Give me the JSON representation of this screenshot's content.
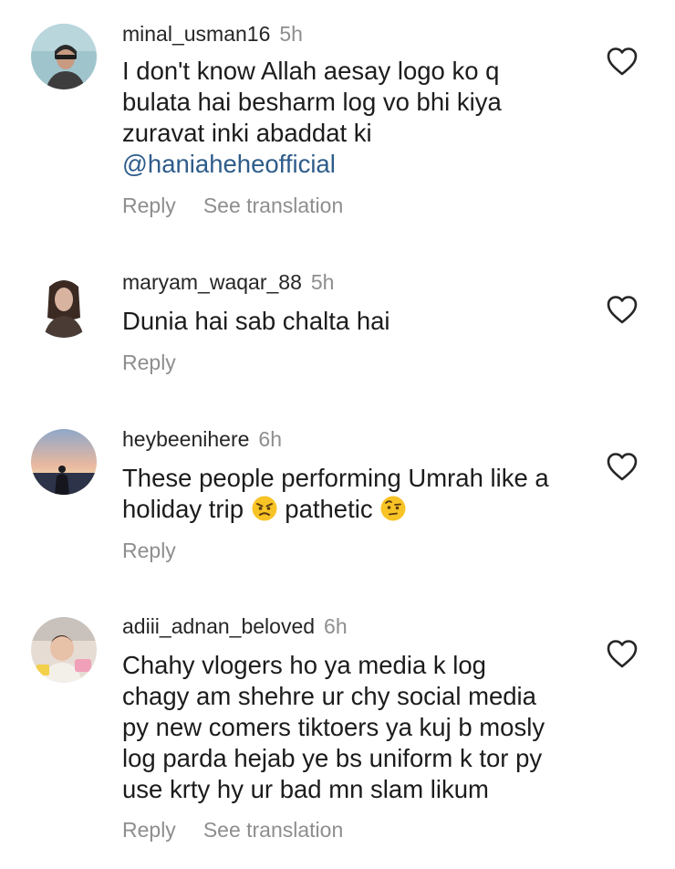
{
  "comments": [
    {
      "username": "minal_usman16",
      "time": "5h",
      "lines": [
        "I don't know Allah aesay logo ko q",
        "bulata hai besharm log vo bhi kiya",
        "zuravat inki abaddat ki"
      ],
      "mention": "@haniaheheofficial",
      "reply_label": "Reply",
      "translate_label": "See translation"
    },
    {
      "username": "maryam_waqar_88",
      "time": "5h",
      "lines": [
        "Dunia hai sab chalta hai"
      ],
      "reply_label": "Reply"
    },
    {
      "username": "heybeenihere",
      "time": "6h",
      "line1": "These people performing Umrah like a",
      "line2_a": "holiday trip",
      "line2_b": "pathetic",
      "emoji1": "angry-face-emoji",
      "emoji2": "face-with-raised-eyebrow-emoji",
      "reply_label": "Reply"
    },
    {
      "username": "adiii_adnan_beloved",
      "time": "6h",
      "lines": [
        "Chahy vlogers ho ya media k log",
        "chagy am shehre  ur chy social media",
        "py new comers tiktoers ya kuj b mosly",
        "log parda hejab ye bs uniform k tor py",
        "use krty hy ur bad  mn slam likum"
      ],
      "reply_label": "Reply",
      "translate_label": "See translation"
    }
  ],
  "icons": {
    "like": "heart-outline-icon"
  },
  "colors": {
    "text": "#262626",
    "muted": "#8e8e8e",
    "mention": "#2e5c8a",
    "background": "#ffffff"
  }
}
